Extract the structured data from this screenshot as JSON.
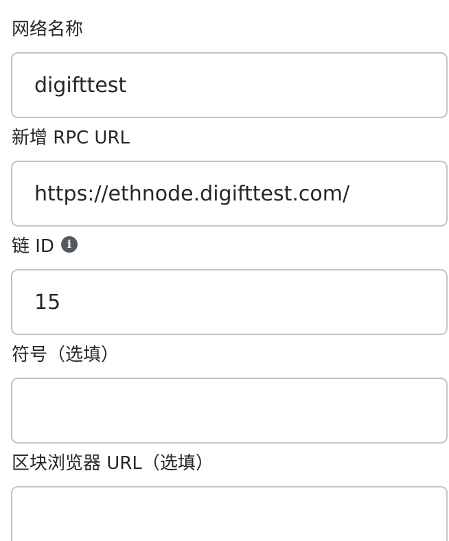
{
  "form": {
    "network_name": {
      "label": "网络名称",
      "value": "digifttest"
    },
    "rpc_url": {
      "label": "新增 RPC URL",
      "value": "https://ethnode.digifttest.com/"
    },
    "chain_id": {
      "label": "链 ID",
      "info_icon": "info-icon",
      "value": "15"
    },
    "symbol": {
      "label": "符号（选填）",
      "value": ""
    },
    "block_explorer_url": {
      "label": "区块浏览器 URL（选填）",
      "value": ""
    }
  }
}
